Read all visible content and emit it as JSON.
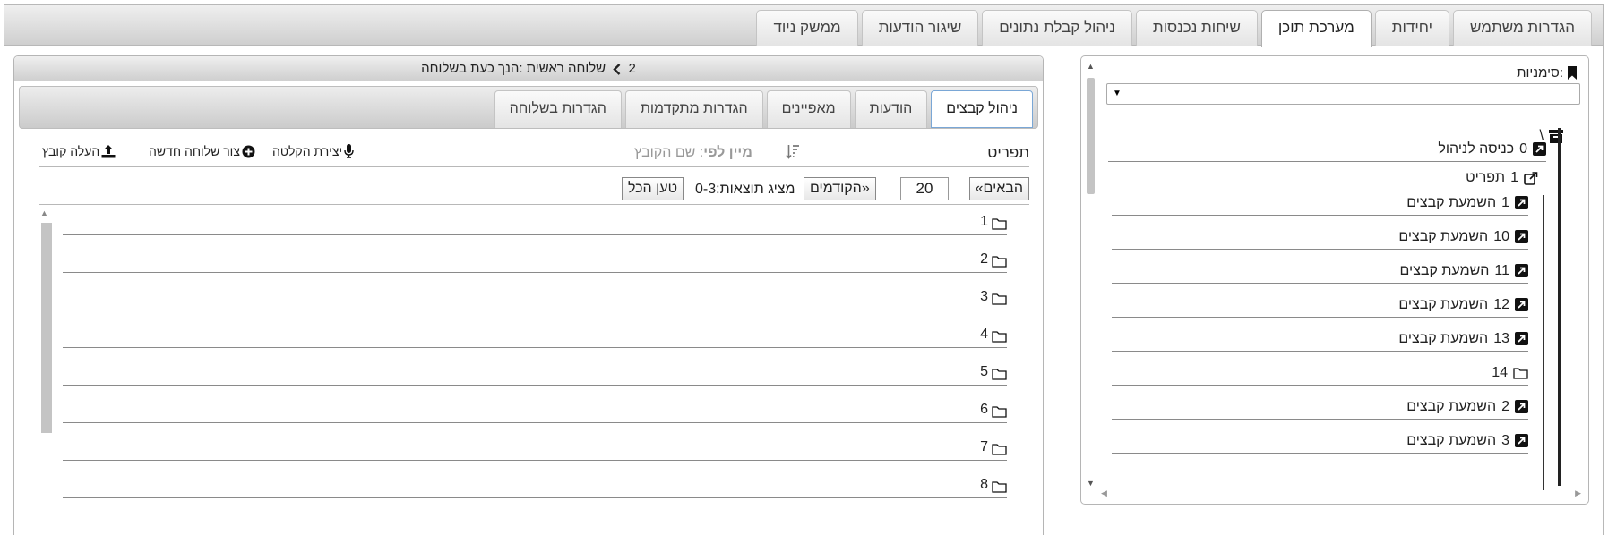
{
  "main_tabs": [
    {
      "label": "הגדרות משתמש",
      "active": false
    },
    {
      "label": "יחידות",
      "active": false
    },
    {
      "label": "מערכת תוכן",
      "active": true
    },
    {
      "label": "שיחות נכנסות",
      "active": false
    },
    {
      "label": "ניהול קבלת נתונים",
      "active": false
    },
    {
      "label": "שיגור הודעות",
      "active": false
    },
    {
      "label": "ממשק ניוד",
      "active": false
    }
  ],
  "bookmarks": {
    "label": "סימניות:",
    "select_value": ""
  },
  "tree": {
    "root_label": "\\",
    "items": [
      {
        "num": "0",
        "text": "כניסה לניהול",
        "icon": "external-box-icon",
        "level": 1
      },
      {
        "num": "1",
        "text": "תפריט",
        "icon": "external-link-icon",
        "level": 1
      },
      {
        "num": "1",
        "text": "השמעת קבצים",
        "icon": "external-box-icon",
        "level": 2
      },
      {
        "num": "10",
        "text": "השמעת קבצים",
        "icon": "external-box-icon",
        "level": 2
      },
      {
        "num": "11",
        "text": "השמעת קבצים",
        "icon": "external-box-icon",
        "level": 2
      },
      {
        "num": "12",
        "text": "השמעת קבצים",
        "icon": "external-box-icon",
        "level": 2
      },
      {
        "num": "13",
        "text": "השמעת קבצים",
        "icon": "external-box-icon",
        "level": 2
      },
      {
        "num": "14",
        "text": "",
        "icon": "folder-icon",
        "level": 2
      },
      {
        "num": "2",
        "text": "השמעת קבצים",
        "icon": "external-box-icon",
        "level": 2
      },
      {
        "num": "3",
        "text": "השמעת קבצים",
        "icon": "external-box-icon",
        "level": 2
      }
    ]
  },
  "panel_header": {
    "prefix": "הנך כעת בשלוחה:",
    "path_root": "שלוחה ראשית",
    "path_current": "2"
  },
  "sub_tabs": [
    {
      "label": "ניהול קבצים",
      "active": true
    },
    {
      "label": "הודעות",
      "active": false
    },
    {
      "label": "מאפיינים",
      "active": false
    },
    {
      "label": "הגדרות מתקדמות",
      "active": false
    },
    {
      "label": "הגדרות בשלוחה",
      "active": false
    }
  ],
  "toolbar": {
    "title": "תפריט",
    "sort_label": "מיין לפי",
    "sort_value": ": שם הקובץ",
    "record_label": "יצירת הקלטה",
    "new_ext_label": "צור שלוחה חדשה",
    "upload_label": "העלה קובץ"
  },
  "pager": {
    "next_label": "«הבאים",
    "page_size": "20",
    "prev_label": "הקודמים»",
    "results_text": "מציג תוצאות:0-3",
    "load_all_label": "טען הכל"
  },
  "files": [
    "1",
    "2",
    "3",
    "4",
    "5",
    "6",
    "7",
    "8"
  ]
}
